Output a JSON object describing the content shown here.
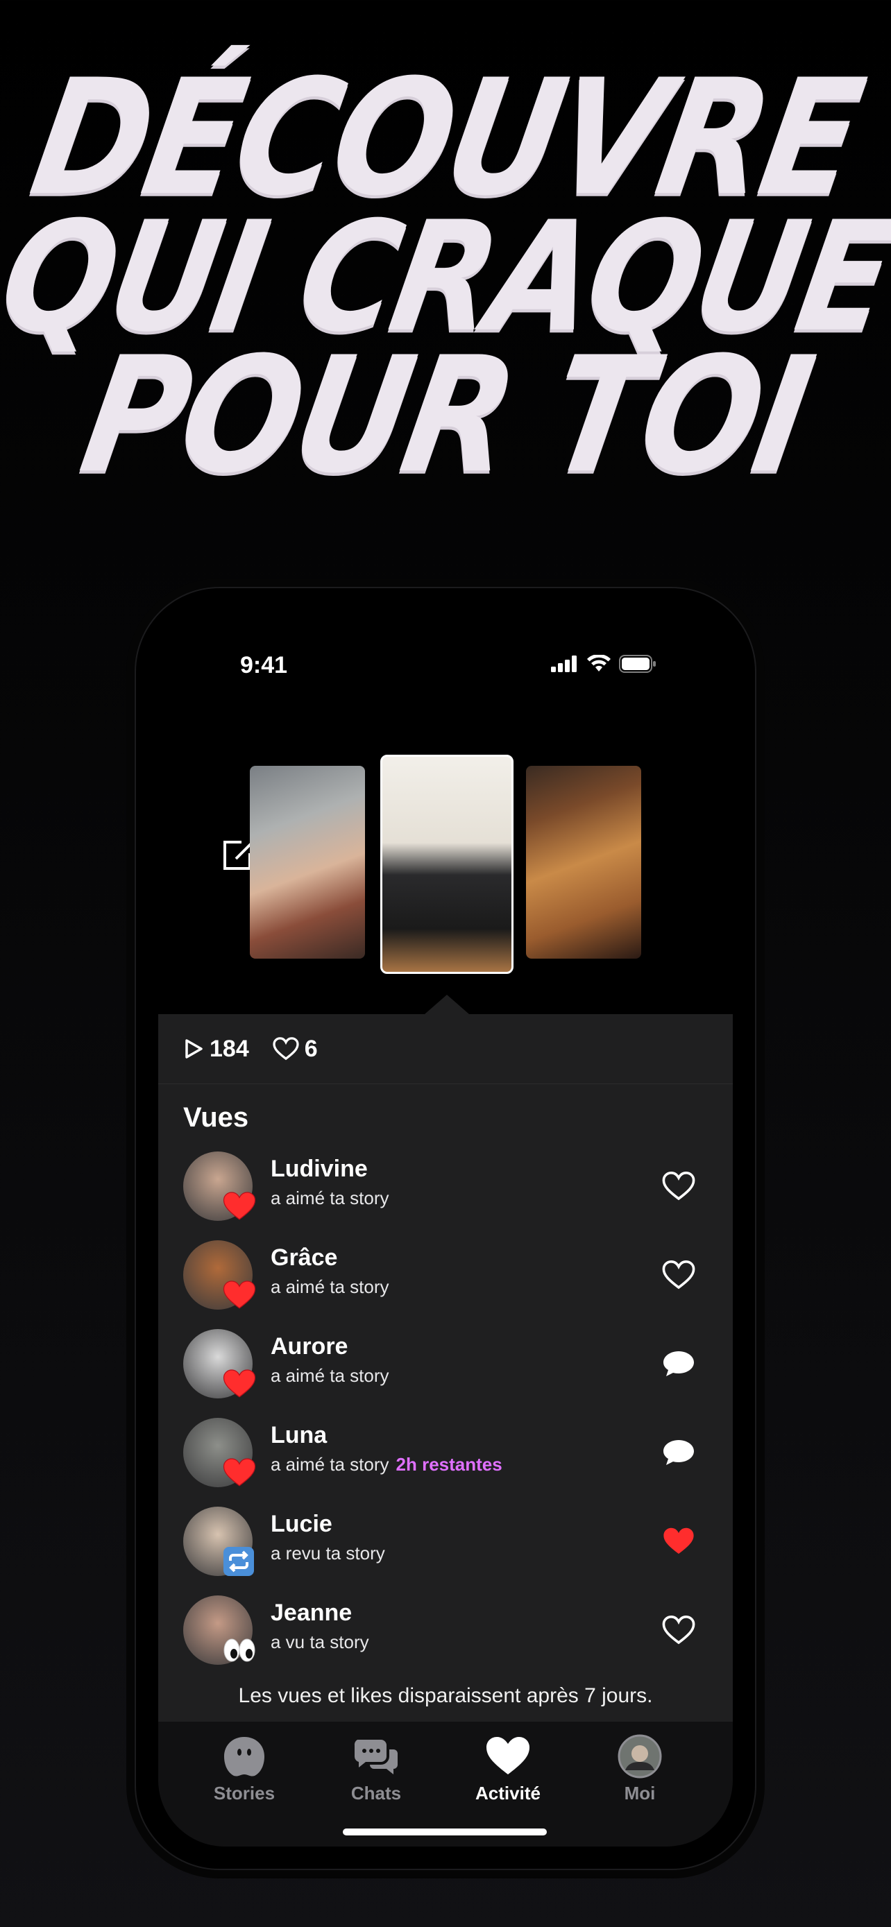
{
  "headline": {
    "line1": "DÉCOUVRE",
    "line2": "QUI CRAQUE",
    "line3": "POUR TOI"
  },
  "status": {
    "time": "9:41"
  },
  "stories": [
    {
      "label": "story-selfie-car"
    },
    {
      "label": "story-mirror-outfit"
    },
    {
      "label": "story-dinner-table"
    }
  ],
  "stats": {
    "views": "184",
    "likes": "6"
  },
  "section": {
    "title": "Vues"
  },
  "viewers": [
    {
      "name": "Ludivine",
      "text": "a aimé ta story",
      "highlight": "",
      "badge": "heart",
      "action": "heart-outline",
      "avatar": "#c9a690"
    },
    {
      "name": "Grâce",
      "text": "a aimé ta story",
      "highlight": "",
      "badge": "heart",
      "action": "heart-outline",
      "avatar": "#b06a3a"
    },
    {
      "name": "Aurore",
      "text": "a aimé ta story",
      "highlight": "",
      "badge": "heart",
      "action": "chat-bubble",
      "avatar": "#d9d9d9"
    },
    {
      "name": "Luna",
      "text": "a aimé ta story",
      "highlight": "2h restantes",
      "badge": "heart",
      "action": "chat-bubble",
      "avatar": "#8d8f8a"
    },
    {
      "name": "Lucie",
      "text": "a revu ta story",
      "highlight": "",
      "badge": "repeat",
      "action": "heart-filled",
      "avatar": "#d7c3b0"
    },
    {
      "name": "Jeanne",
      "text": "a vu ta story",
      "highlight": "",
      "badge": "eyes",
      "action": "heart-outline",
      "avatar": "#c49a86"
    }
  ],
  "footer_note": "Les vues et likes disparaissent après 7 jours.",
  "tabs": [
    {
      "label": "Stories",
      "icon": "ghost-icon"
    },
    {
      "label": "Chats",
      "icon": "chats-icon"
    },
    {
      "label": "Activité",
      "icon": "heart-icon"
    },
    {
      "label": "Moi",
      "icon": "avatar-icon"
    }
  ],
  "colors": {
    "highlight": "#e070ff",
    "like_red": "#ff2d2d",
    "panel": "#1f1f20"
  }
}
